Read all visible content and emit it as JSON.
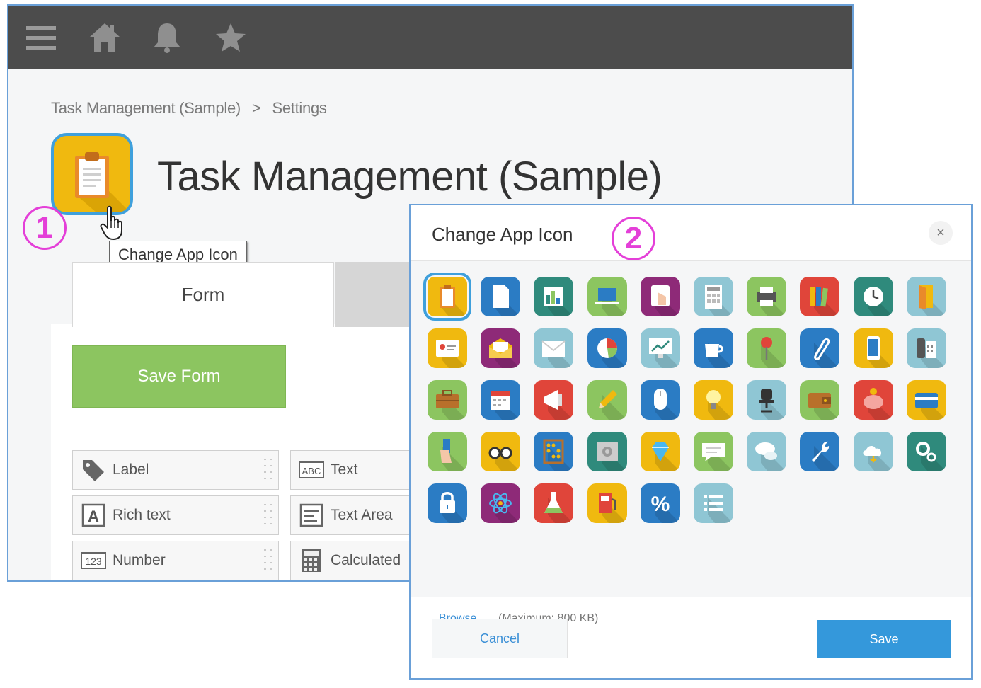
{
  "topbar": {
    "icons": [
      "menu-icon",
      "home-icon",
      "bell-icon",
      "star-icon"
    ],
    "color": "#4c4c4c"
  },
  "breadcrumb": {
    "app": "Task Management (Sample)",
    "separator": ">",
    "current": "Settings"
  },
  "app": {
    "title": "Task Management (Sample)",
    "icon": "clipboard-icon",
    "icon_color": "#f0b90f"
  },
  "annotations": {
    "step1": "1",
    "step2": "2",
    "color": "#e43fd8"
  },
  "tooltip": {
    "text": "Change App Icon"
  },
  "tabs": {
    "form": "Form"
  },
  "form": {
    "save_label": "Save Form",
    "save_color": "#8cc560",
    "fields": [
      {
        "label": "Label",
        "icon": "tag-icon"
      },
      {
        "label": "Text",
        "icon": "abc-text-icon"
      },
      {
        "label": "Rich text",
        "icon": "rich-text-icon"
      },
      {
        "label": "Text Area",
        "icon": "text-area-icon"
      },
      {
        "label": "Number",
        "icon": "number-icon"
      },
      {
        "label": "Calculated",
        "icon": "calculator-icon"
      }
    ]
  },
  "dialog": {
    "title": "Change App Icon",
    "close": "×",
    "browse": "Browse",
    "max_size": "(Maximum: 800 KB)",
    "cancel": "Cancel",
    "save": "Save",
    "save_color": "#3498db",
    "selected_index": 0,
    "icons": [
      {
        "name": "clipboard-icon",
        "color": "#f0b90f"
      },
      {
        "name": "document-icon",
        "color": "#2b7cc4"
      },
      {
        "name": "bar-chart-icon",
        "color": "#2f8a7c"
      },
      {
        "name": "laptop-icon",
        "color": "#8cc560"
      },
      {
        "name": "hand-touch-icon",
        "color": "#8e2a78"
      },
      {
        "name": "calculator-icon",
        "color": "#8fc6d4"
      },
      {
        "name": "printer-icon",
        "color": "#8cc560"
      },
      {
        "name": "binders-icon",
        "color": "#e0453a"
      },
      {
        "name": "clock-icon",
        "color": "#2f8a7c"
      },
      {
        "name": "door-icon",
        "color": "#8fc6d4"
      },
      {
        "name": "id-card-icon",
        "color": "#f0b90f"
      },
      {
        "name": "envelope-open-icon",
        "color": "#8e2a78"
      },
      {
        "name": "envelope-icon",
        "color": "#8fc6d4"
      },
      {
        "name": "pie-chart-icon",
        "color": "#2b7cc4"
      },
      {
        "name": "monitor-chart-icon",
        "color": "#8fc6d4"
      },
      {
        "name": "coffee-cup-icon",
        "color": "#2b7cc4"
      },
      {
        "name": "pushpin-icon",
        "color": "#8cc560"
      },
      {
        "name": "paperclip-icon",
        "color": "#2b7cc4"
      },
      {
        "name": "smartphone-icon",
        "color": "#f0b90f"
      },
      {
        "name": "fax-phone-icon",
        "color": "#8fc6d4"
      },
      {
        "name": "briefcase-icon",
        "color": "#8cc560"
      },
      {
        "name": "calendar-icon",
        "color": "#2b7cc4"
      },
      {
        "name": "megaphone-icon",
        "color": "#e0453a"
      },
      {
        "name": "pencil-icon",
        "color": "#8cc560"
      },
      {
        "name": "mouse-icon",
        "color": "#2b7cc4"
      },
      {
        "name": "lightbulb-icon",
        "color": "#f0b90f"
      },
      {
        "name": "office-chair-icon",
        "color": "#8fc6d4"
      },
      {
        "name": "wallet-icon",
        "color": "#8cc560"
      },
      {
        "name": "piggy-bank-icon",
        "color": "#e0453a"
      },
      {
        "name": "credit-card-icon",
        "color": "#f0b90f"
      },
      {
        "name": "card-in-hand-icon",
        "color": "#8cc560"
      },
      {
        "name": "glasses-icon",
        "color": "#f0b90f"
      },
      {
        "name": "abacus-icon",
        "color": "#2b7cc4"
      },
      {
        "name": "safe-icon",
        "color": "#2f8a7c"
      },
      {
        "name": "diamond-icon",
        "color": "#f0b90f"
      },
      {
        "name": "speech-bubble-icon",
        "color": "#8cc560"
      },
      {
        "name": "chat-bubbles-icon",
        "color": "#8fc6d4"
      },
      {
        "name": "wrench-icon",
        "color": "#2b7cc4"
      },
      {
        "name": "cloud-icon",
        "color": "#8fc6d4"
      },
      {
        "name": "gears-icon",
        "color": "#2f8a7c"
      },
      {
        "name": "lock-icon",
        "color": "#2b7cc4"
      },
      {
        "name": "atom-icon",
        "color": "#8e2a78"
      },
      {
        "name": "flask-icon",
        "color": "#e0453a"
      },
      {
        "name": "fuel-pump-icon",
        "color": "#f0b90f"
      },
      {
        "name": "percent-icon",
        "color": "#2b7cc4"
      },
      {
        "name": "list-icon",
        "color": "#8fc6d4"
      }
    ]
  }
}
